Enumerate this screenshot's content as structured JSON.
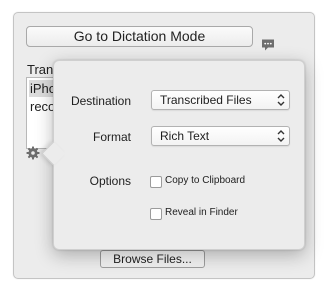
{
  "main": {
    "dictation_button_label": "Go to Dictation Mode",
    "list_title": "Transc",
    "list_items": [
      "iPhon",
      "recor"
    ],
    "browse_button_label": "Browse Files..."
  },
  "popover": {
    "destination_label": "Destination",
    "destination_value": "Transcribed Files",
    "format_label": "Format",
    "format_value": "Rich Text",
    "options_label": "Options",
    "copy_to_clipboard_label": "Copy to Clipboard",
    "copy_to_clipboard_checked": false,
    "reveal_in_finder_label": "Reveal in Finder",
    "reveal_in_finder_checked": false
  },
  "icons": {
    "chat": "speech-bubble-icon",
    "settings": "gear-icon",
    "popup_arrows": "up-down-chevron-icon"
  },
  "colors": {
    "window_bg": "#ececec",
    "list_selection": "#dcdcdc"
  }
}
